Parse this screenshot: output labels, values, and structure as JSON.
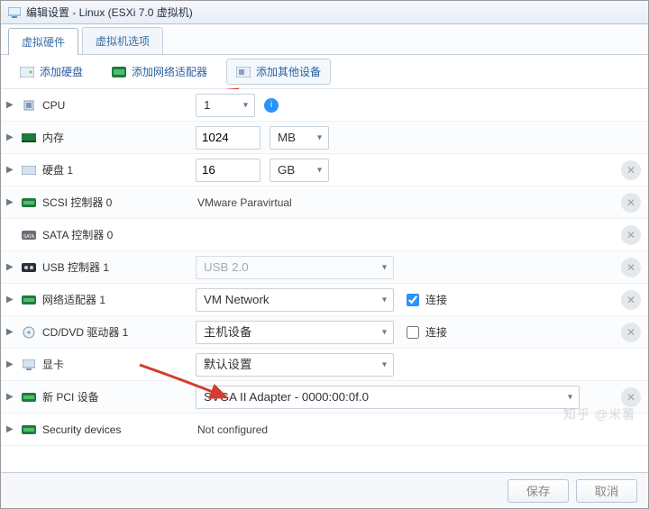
{
  "titlebar": {
    "text": "编辑设置 - Linux (ESXi 7.0 虚拟机)"
  },
  "tabs": {
    "t0": "虚拟硬件",
    "t1": "虚拟机选项"
  },
  "toolbar": {
    "add_disk": "添加硬盘",
    "add_nic": "添加网络适配器",
    "add_other": "添加其他设备"
  },
  "rows": {
    "cpu": {
      "label": "CPU",
      "value": "1"
    },
    "memory": {
      "label": "内存",
      "value": "1024",
      "unit": "MB"
    },
    "disk": {
      "label": "硬盘 1",
      "value": "16",
      "unit": "GB"
    },
    "scsi": {
      "label": "SCSI 控制器 0",
      "value": "VMware Paravirtual"
    },
    "sata": {
      "label": "SATA 控制器 0"
    },
    "usb": {
      "label": "USB 控制器 1",
      "value": "USB 2.0"
    },
    "nic": {
      "label": "网络适配器 1",
      "value": "VM Network",
      "connect": "连接"
    },
    "cdrom": {
      "label": "CD/DVD 驱动器 1",
      "value": "主机设备",
      "connect": "连接"
    },
    "video": {
      "label": "显卡",
      "value": "默认设置"
    },
    "pci": {
      "label": "新 PCI 设备",
      "badge": "新",
      "value": "SVGA II Adapter - 0000:00:0f.0"
    },
    "sec": {
      "label": "Security devices",
      "value": "Not configured"
    }
  },
  "footer": {
    "save": "保存",
    "cancel": "取消"
  },
  "watermark": "知乎 @米薯"
}
